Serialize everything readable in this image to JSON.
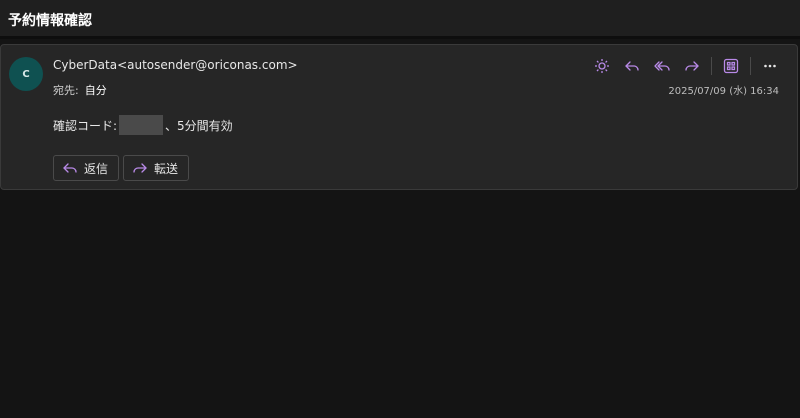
{
  "subject": "予約情報確認",
  "message": {
    "avatar_initial": "C",
    "sender": "CyberData<autosender@oriconas.com>",
    "to_label": "宛先:",
    "to_value": "自分",
    "date": "2025/07/09 (水) 16:34",
    "body_prefix": "確認コード:",
    "body_suffix": "、5分間有効"
  },
  "toolbar": {
    "icons": [
      "sun-icon",
      "reply-icon",
      "reply-all-icon",
      "forward-icon",
      "apps-icon",
      "more-icon"
    ]
  },
  "actions": {
    "reply_label": "返信",
    "forward_label": "転送"
  },
  "colors": {
    "accent": "#b98ae8",
    "avatar_bg": "#0f5151",
    "background": "#141414",
    "card": "#262626"
  }
}
